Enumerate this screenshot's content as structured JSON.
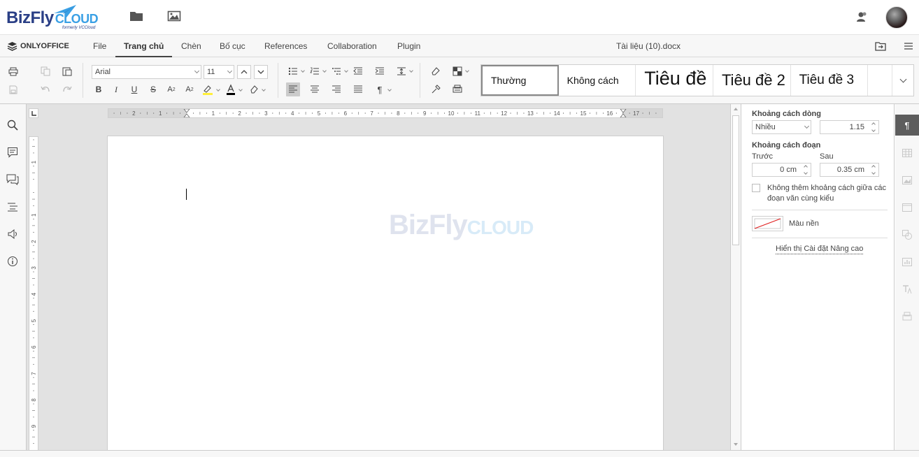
{
  "app": {
    "brand_name": "BizFly",
    "brand_cloud": "CLOUD",
    "brand_sub": "formerly VCCloud",
    "editor_name": "ONLYOFFICE",
    "doc_title": "Tài liệu (10).docx"
  },
  "tabs": [
    {
      "label": "File"
    },
    {
      "label": "Trang chủ"
    },
    {
      "label": "Chèn"
    },
    {
      "label": "Bố cục"
    },
    {
      "label": "References"
    },
    {
      "label": "Collaboration"
    },
    {
      "label": "Plugin"
    }
  ],
  "toolbar": {
    "font_name": "Arial",
    "font_size": "11",
    "styles": [
      "Thường",
      "Không cách",
      "Tiêu đề 1",
      "Tiêu đề 2",
      "Tiêu đề 3"
    ]
  },
  "ruler": {
    "h_ticks": [
      "2",
      "1",
      "1",
      "2",
      "3",
      "4",
      "5",
      "6",
      "7",
      "8",
      "9",
      "10",
      "11",
      "12",
      "13",
      "14",
      "15",
      "16",
      "17"
    ],
    "v_ticks": [
      "1",
      "1",
      "2",
      "3",
      "4",
      "5",
      "6",
      "7",
      "8",
      "9"
    ]
  },
  "right_panel": {
    "line_spacing_title": "Khoảng cách dòng",
    "line_spacing_mode": "Nhiều",
    "line_spacing_value": "1.15",
    "paragraph_spacing_title": "Khoảng cách đoạn",
    "before_label": "Trước",
    "before_value": "0 cm",
    "after_label": "Sau",
    "after_value": "0.35 cm",
    "no_space_checkbox": "Không thêm khoảng cách giữa các đoạn văn cùng kiểu",
    "background_color_label": "Màu nền",
    "advanced_link": "Hiển thị Cài đặt Nâng cao"
  },
  "watermark": {
    "text": "BizFly",
    "cloud": "CLOUD"
  },
  "colors": {
    "brand_blue": "#2a3f86",
    "cloud_blue": "#3aa0e5",
    "active_side": "#5d5d5d"
  }
}
